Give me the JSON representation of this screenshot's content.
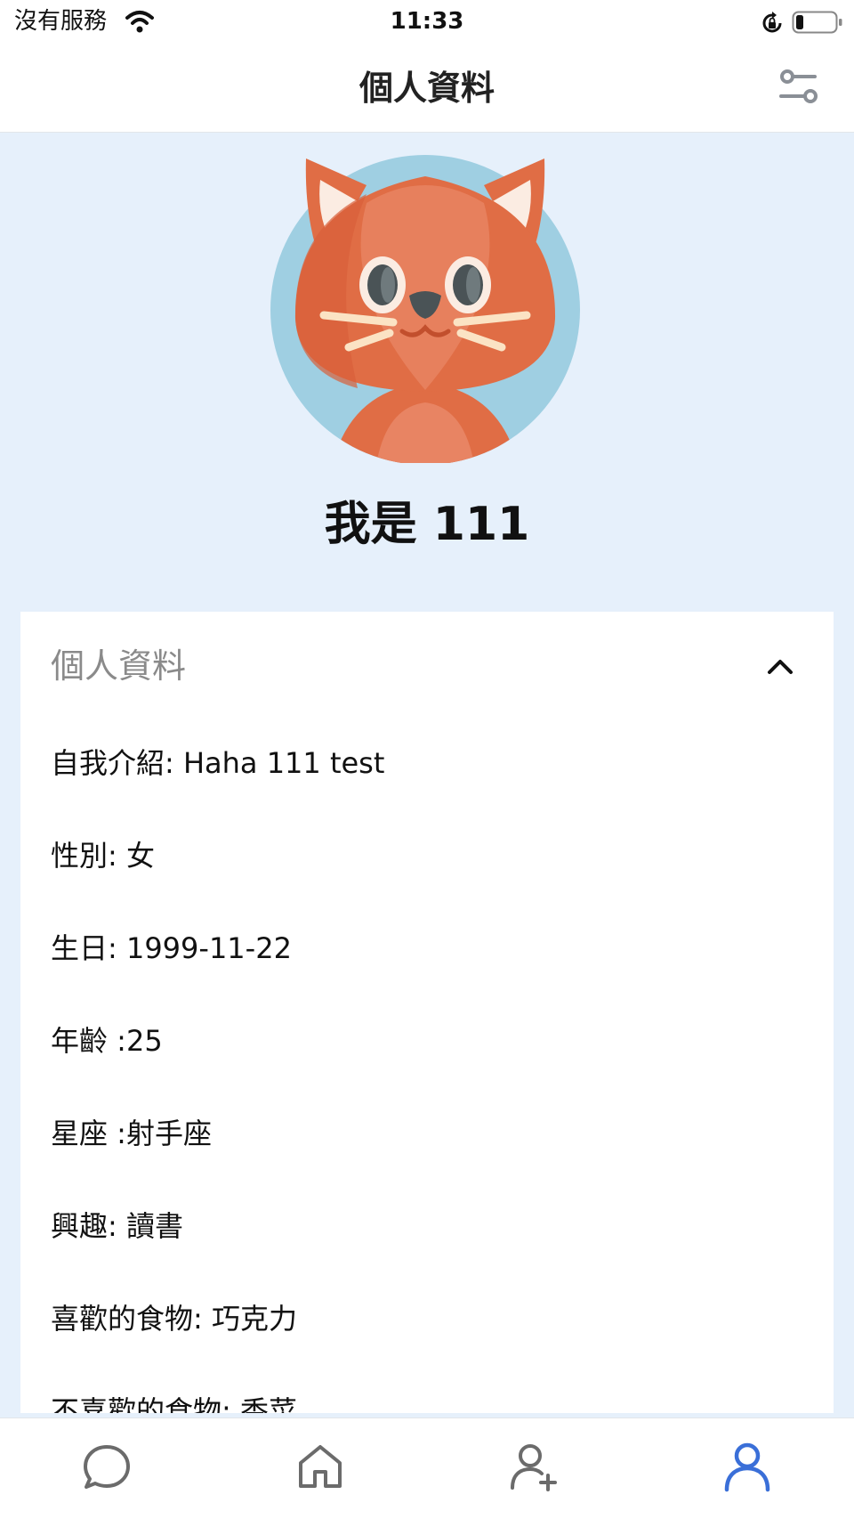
{
  "status_bar": {
    "carrier": "沒有服務",
    "time": "11:33"
  },
  "nav": {
    "title": "個人資料",
    "filter_icon": "sliders-icon"
  },
  "profile": {
    "avatar_icon": "cat-avatar",
    "name": "我是 111"
  },
  "info_section": {
    "title": "個人資料",
    "expanded": true,
    "rows": [
      "自我介紹: Haha 111 test",
      "性別: 女",
      "生日: 1999-11-22",
      "年齡 :25",
      "星座 :射手座",
      "興趣: 讀書",
      "喜歡的食物: 巧克力",
      "不喜歡的食物: 香菜"
    ]
  },
  "tab_bar": {
    "tabs": [
      {
        "name": "chat",
        "icon": "chat-bubble-icon",
        "active": false
      },
      {
        "name": "home",
        "icon": "home-icon",
        "active": false
      },
      {
        "name": "add-friend",
        "icon": "user-plus-icon",
        "active": false
      },
      {
        "name": "profile",
        "icon": "user-icon",
        "active": true
      }
    ],
    "active_color": "#3a6fd8",
    "inactive_color": "#6b6b6b"
  },
  "colors": {
    "background": "#e6f0fb",
    "avatar_circle": "#9fcfe2",
    "cat_orange": "#e06d45"
  }
}
